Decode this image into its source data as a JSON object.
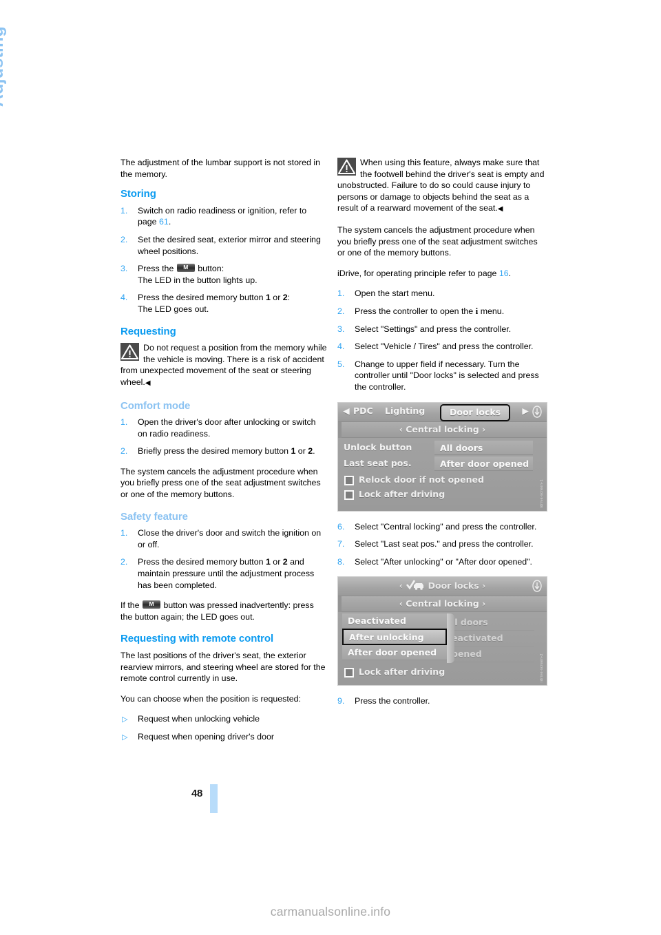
{
  "chapter": {
    "label": "Adjusting"
  },
  "page": {
    "number": "48",
    "footer_watermark": "carmanualsonline.info"
  },
  "left_column": {
    "intro_paragraph": "The adjustment of the lumbar support is not stored in the memory.",
    "storing": {
      "heading": "Storing",
      "steps": [
        {
          "num": "1.",
          "text_a": "Switch on radio readiness or ignition, refer to page ",
          "page_ref": "61",
          "text_b": "."
        },
        {
          "num": "2.",
          "text_a": "Set the desired seat, exterior mirror and steering wheel positions."
        },
        {
          "num": "3.",
          "text_a": "Press the ",
          "button_glyph": "M",
          "text_b": " button:",
          "text_c": "The LED in the button lights up."
        },
        {
          "num": "4.",
          "text_a": "Press the desired memory button ",
          "bold_a": "1",
          "text_b": " or ",
          "bold_b": "2",
          "text_c": ":",
          "text_d": "The LED goes out."
        }
      ]
    },
    "requesting": {
      "heading": "Requesting",
      "warning_icon": "warning-triangle-icon",
      "warning_text": "Do not request a position from the memory while the vehicle is moving. There is a risk of accident from unexpected movement of the seat or steering wheel.",
      "warning_endmark": "◀"
    },
    "comfort_mode": {
      "heading": "Comfort mode",
      "steps": [
        {
          "num": "1.",
          "text_a": "Open the driver's door after unlocking or switch on radio readiness."
        },
        {
          "num": "2.",
          "text_a": "Briefly press the desired memory button ",
          "bold_a": "1",
          "text_b": " or ",
          "bold_b": "2",
          "text_c": "."
        }
      ],
      "closing_paragraph": "The system cancels the adjustment procedure when you briefly press one of the seat adjustment switches or one of the memory buttons."
    },
    "safety_feature": {
      "heading": "Safety feature",
      "steps": [
        {
          "num": "1.",
          "text_a": "Close the driver's door and switch the ignition on or off."
        },
        {
          "num": "2.",
          "text_a": "Press the desired memory button ",
          "bold_a": "1",
          "text_b": " or ",
          "bold_b": "2",
          "text_c": " and maintain pressure until the adjustment process has been completed."
        }
      ],
      "closing_a": "If the ",
      "closing_button_glyph": "M",
      "closing_b": " button was pressed inadvertently: press the button again; the LED goes out."
    },
    "requesting_remote": {
      "heading": "Requesting with remote control",
      "paragraph_1": "The last positions of the driver's seat, the exterior rearview mirrors, and steering wheel are stored for the remote control currently in use.",
      "paragraph_2": "You can choose when the position is requested:",
      "bullets": [
        "Request when unlocking vehicle",
        "Request when opening driver's door"
      ]
    }
  },
  "right_column": {
    "warning": {
      "icon": "warning-triangle-icon",
      "text": "When using this feature, always make sure that the footwell behind the driver's seat is empty and unobstructed. Failure to do so could cause injury to persons or damage to objects behind the seat as a result of a rearward movement of the seat.",
      "endmark": "◀"
    },
    "cancel_paragraph": "The system cancels the adjustment procedure when you briefly press one of the seat adjustment switches or one of the memory buttons.",
    "idrive_ref": {
      "text_a": "iDrive, for operating principle refer to page ",
      "page_ref": "16",
      "text_b": "."
    },
    "steps_1_5": [
      {
        "num": "1.",
        "text_a": "Open the start menu."
      },
      {
        "num": "2.",
        "text_a": "Press the controller to open the ",
        "glyph": "i",
        "text_b": " menu."
      },
      {
        "num": "3.",
        "text_a": "Select \"Settings\" and press the controller."
      },
      {
        "num": "4.",
        "text_a": "Select \"Vehicle / Tires\" and press the controller."
      },
      {
        "num": "5.",
        "text_a": "Change to upper field if necessary. Turn the controller until \"Door locks\" is selected and press the controller."
      }
    ],
    "idrive_screen_1": {
      "nav_left_arrow": "◀",
      "nav_right_arrow": "▶",
      "tabs": [
        "PDC",
        "Lighting"
      ],
      "selected_tab": "Door locks",
      "right_icon": "down-arrow-circle-icon",
      "subtitle": "‹ Central locking ›",
      "rows": [
        {
          "label": "Unlock button",
          "value": "All doors"
        },
        {
          "label": "Last seat pos.",
          "value": "After door opened"
        }
      ],
      "checkboxes": [
        "Relock door if not opened",
        "Lock after driving"
      ],
      "watermark": "idrive-screen-1"
    },
    "steps_6_8": [
      {
        "num": "6.",
        "text_a": "Select \"Central locking\" and press the controller."
      },
      {
        "num": "7.",
        "text_a": "Select \"Last seat pos.\" and press the controller."
      },
      {
        "num": "8.",
        "text_a": "Select \"After unlocking\" or \"After door opened\"."
      }
    ],
    "idrive_screen_2": {
      "title_left_arrow": "‹",
      "title_right_arrow": "›",
      "title_icon": "check-car-icon",
      "title": "Door locks",
      "right_icon": "down-arrow-circle-icon",
      "subtitle": "‹ Central locking ›",
      "options": [
        {
          "label": "Deactivated",
          "selected": false
        },
        {
          "label": "After unlocking",
          "selected": true
        },
        {
          "label": "After door opened",
          "selected": false
        }
      ],
      "ghost_values": [
        "ll doors",
        "eactivated",
        "pened"
      ],
      "checkbox": "Lock after driving",
      "watermark": "idrive-screen-2"
    },
    "step_9": {
      "num": "9.",
      "text_a": "Press the controller."
    }
  },
  "colors": {
    "heading_blue": "#0b9bf0",
    "pale_blue": "#8cc3f2",
    "number_blue": "#2ea3f2",
    "page_bar": "#b8dcfa"
  }
}
